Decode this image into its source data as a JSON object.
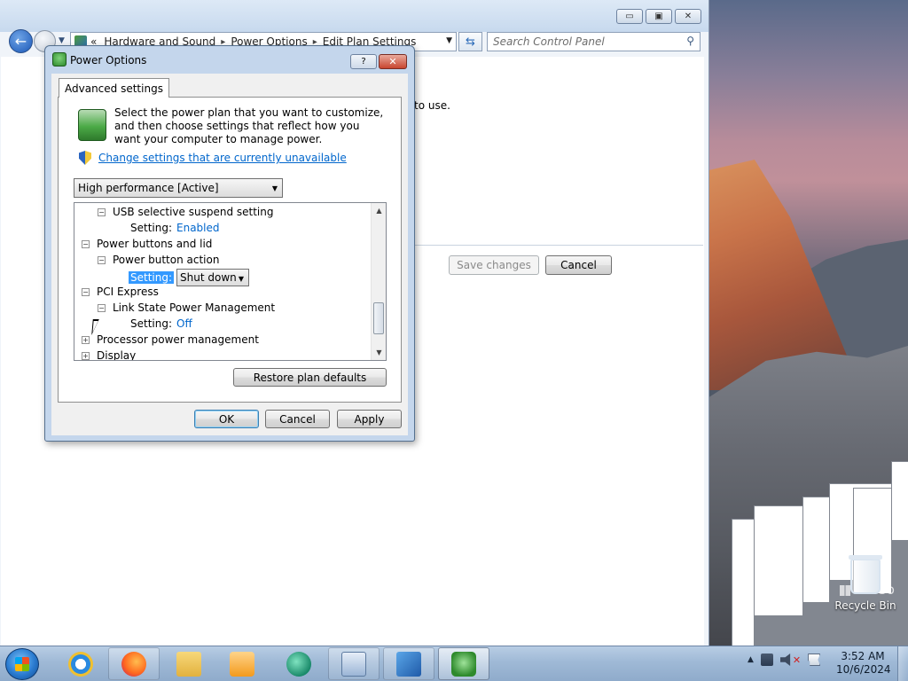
{
  "desktop": {
    "recycle_bin_label": "Recycle Bin",
    "watermark_text": "icroso"
  },
  "control_panel": {
    "breadcrumb": [
      "Hardware and Sound",
      "Power Options",
      "Edit Plan Settings"
    ],
    "breadcrumb_prefix": "«",
    "search_placeholder": "Search Control Panel",
    "hint_text": "to use.",
    "save_label": "Save changes",
    "cancel_label": "Cancel",
    "window_buttons": {
      "minimize": "▭",
      "maximize": "▣",
      "close": "✕"
    }
  },
  "dialog": {
    "title": "Power Options",
    "help_label": "?",
    "close_label": "✕",
    "tab_label": "Advanced settings",
    "intro_text": "Select the power plan that you want to customize, and then choose settings that reflect how you want your computer to manage power.",
    "change_link": "Change settings that are currently unavailable",
    "plan_selected": "High performance [Active]",
    "tree": [
      {
        "level": 1,
        "toggle": "−",
        "label": "USB selective suspend setting"
      },
      {
        "level": 2,
        "label": "Setting:",
        "value": "Enabled"
      },
      {
        "level": 0,
        "toggle": "−",
        "label": "Power buttons and lid"
      },
      {
        "level": 1,
        "toggle": "−",
        "label": "Power button action"
      },
      {
        "level": 2,
        "label": "Setting:",
        "value": "Shut down",
        "editing": true
      },
      {
        "level": 0,
        "toggle": "−",
        "label": "PCI Express"
      },
      {
        "level": 1,
        "toggle": "−",
        "label": "Link State Power Management"
      },
      {
        "level": 2,
        "label": "Setting:",
        "value": "Off"
      },
      {
        "level": 0,
        "toggle": "+",
        "label": "Processor power management"
      },
      {
        "level": 0,
        "toggle": "+",
        "label": "Display"
      }
    ],
    "restore_label": "Restore plan defaults",
    "ok_label": "OK",
    "cancel_label": "Cancel",
    "apply_label": "Apply"
  },
  "taskbar": {
    "items": [
      {
        "name": "internet-explorer",
        "state": "idle"
      },
      {
        "name": "firefox",
        "state": "open"
      },
      {
        "name": "file-explorer",
        "state": "idle"
      },
      {
        "name": "media-player",
        "state": "idle"
      },
      {
        "name": "app-green-circle",
        "state": "idle"
      },
      {
        "name": "control-panel-window",
        "state": "open"
      },
      {
        "name": "network-settings",
        "state": "open"
      },
      {
        "name": "power-options",
        "state": "active"
      }
    ],
    "tray_chevron": "▲",
    "time": "3:52 AM",
    "date": "10/6/2024"
  },
  "colors": {
    "link": "#0066cc",
    "selection": "#3399ff",
    "dialog_frame": "#c4d6ec"
  }
}
